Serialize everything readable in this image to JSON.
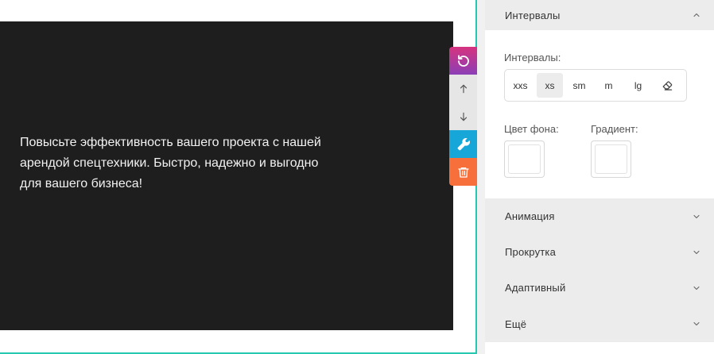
{
  "canvas": {
    "hero_text": "Повысьте эффективность вашего проекта с нашей арендой спецтехники. Быстро, надежно и выгодно для вашего бизнеса!"
  },
  "toolbar": {
    "reset_icon": "reset-icon",
    "up_icon": "arrow-up-icon",
    "down_icon": "arrow-down-icon",
    "settings_icon": "wrench-icon",
    "delete_icon": "trash-icon"
  },
  "panel": {
    "intervals_section": {
      "title": "Интервалы",
      "field_label": "Интервалы:",
      "sizes": [
        "xxs",
        "xs",
        "sm",
        "m",
        "lg"
      ],
      "active_size": "xs",
      "bg_color_label": "Цвет фона:",
      "gradient_label": "Градиент:",
      "bg_color_value": "#ffffff",
      "gradient_value": "#ffffff"
    },
    "sections": [
      {
        "title": "Анимация"
      },
      {
        "title": "Прокрутка"
      },
      {
        "title": "Адаптивный"
      },
      {
        "title": "Ещё"
      }
    ]
  },
  "colors": {
    "accent_frame": "#27c8b1",
    "dark_block": "#1e1e1e",
    "reset_gradient": [
      "#d6337f",
      "#8b3fb6"
    ],
    "settings_button": "#17a6d8",
    "delete_button": "#f7703b"
  }
}
